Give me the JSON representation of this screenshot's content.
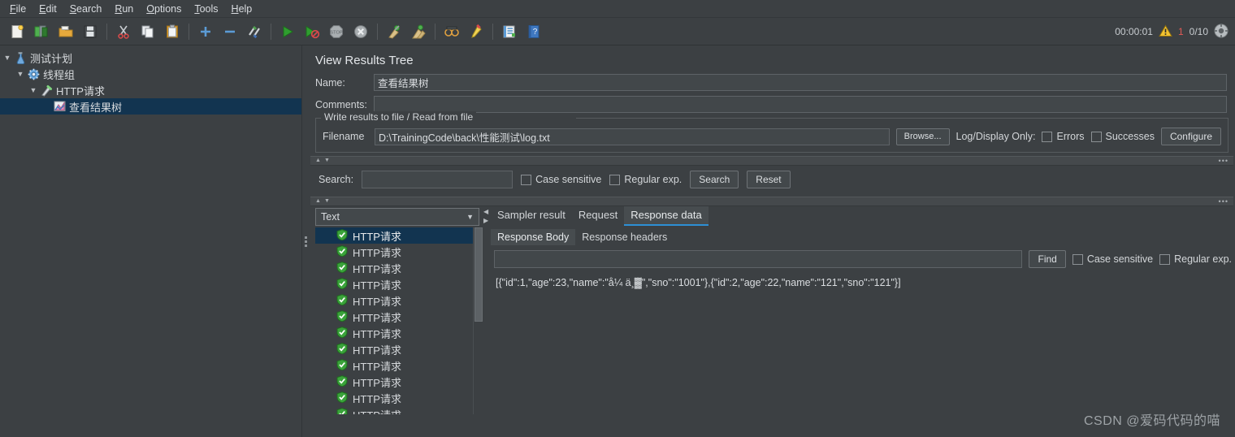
{
  "menubar": {
    "items": [
      {
        "label": "File",
        "mnemonic": "F"
      },
      {
        "label": "Edit",
        "mnemonic": "E"
      },
      {
        "label": "Search",
        "mnemonic": "S"
      },
      {
        "label": "Run",
        "mnemonic": "R"
      },
      {
        "label": "Options",
        "mnemonic": "O"
      },
      {
        "label": "Tools",
        "mnemonic": "T"
      },
      {
        "label": "Help",
        "mnemonic": "H"
      }
    ]
  },
  "toolbar": {
    "buttons": [
      {
        "name": "new-icon",
        "title": "New"
      },
      {
        "name": "templates-icon",
        "title": "Templates"
      },
      {
        "name": "open-icon",
        "title": "Open"
      },
      {
        "name": "save-icon",
        "title": "Save"
      },
      {
        "name": "cut-icon",
        "title": "Cut"
      },
      {
        "name": "copy-icon",
        "title": "Copy"
      },
      {
        "name": "paste-icon",
        "title": "Paste"
      },
      {
        "name": "expand-all-icon",
        "title": "Expand all"
      },
      {
        "name": "collapse-all-icon",
        "title": "Collapse all"
      },
      {
        "name": "toggle-icon",
        "title": "Toggle"
      },
      {
        "name": "start-icon",
        "title": "Start"
      },
      {
        "name": "start-no-pauses-icon",
        "title": "Start no pauses"
      },
      {
        "name": "stop-icon",
        "title": "Stop"
      },
      {
        "name": "shutdown-icon",
        "title": "Shutdown"
      },
      {
        "name": "clear-icon",
        "title": "Clear"
      },
      {
        "name": "clear-all-icon",
        "title": "Clear all"
      },
      {
        "name": "search-icon",
        "title": "Search"
      },
      {
        "name": "search-reset-icon",
        "title": "Reset search"
      },
      {
        "name": "function-helper-icon",
        "title": "Function helper dialog"
      },
      {
        "name": "help-icon",
        "title": "Help"
      }
    ]
  },
  "status": {
    "elapsed": "00:00:01",
    "warning_count": "1",
    "threads": "0/10",
    "warning_color": "#e05a57"
  },
  "tree": {
    "nodes": [
      {
        "label": "测试计划",
        "icon": "test-plan-icon",
        "depth": 0,
        "expanded": true,
        "selected": false
      },
      {
        "label": "线程组",
        "icon": "thread-group-icon",
        "depth": 1,
        "expanded": true,
        "selected": false
      },
      {
        "label": "HTTP请求",
        "icon": "http-request-icon",
        "depth": 2,
        "expanded": true,
        "selected": false
      },
      {
        "label": "查看结果树",
        "icon": "view-results-tree-icon",
        "depth": 3,
        "expanded": false,
        "selected": true
      }
    ]
  },
  "panel": {
    "title": "View Results Tree",
    "name_label": "Name:",
    "name_value": "查看结果树",
    "comments_label": "Comments:",
    "comments_value": "",
    "file_group": {
      "legend": "Write results to file / Read from file",
      "filename_label": "Filename",
      "filename_value": "D:\\TrainingCode\\back\\性能测试\\log.txt",
      "browse_label": "Browse...",
      "log_display_label": "Log/Display Only:",
      "errors_label": "Errors",
      "errors_checked": false,
      "successes_label": "Successes",
      "successes_checked": false,
      "configure_label": "Configure"
    },
    "search_bar": {
      "label": "Search:",
      "value": "",
      "case_sensitive_label": "Case sensitive",
      "case_sensitive_checked": false,
      "regex_label": "Regular exp.",
      "regex_checked": false,
      "search_button": "Search",
      "reset_button": "Reset"
    },
    "renderer": {
      "selected": "Text"
    },
    "results": [
      {
        "label": "HTTP请求",
        "status": "success",
        "selected": true
      },
      {
        "label": "HTTP请求",
        "status": "success",
        "selected": false
      },
      {
        "label": "HTTP请求",
        "status": "success",
        "selected": false
      },
      {
        "label": "HTTP请求",
        "status": "success",
        "selected": false
      },
      {
        "label": "HTTP请求",
        "status": "success",
        "selected": false
      },
      {
        "label": "HTTP请求",
        "status": "success",
        "selected": false
      },
      {
        "label": "HTTP请求",
        "status": "success",
        "selected": false
      },
      {
        "label": "HTTP请求",
        "status": "success",
        "selected": false
      },
      {
        "label": "HTTP请求",
        "status": "success",
        "selected": false
      },
      {
        "label": "HTTP请求",
        "status": "success",
        "selected": false
      },
      {
        "label": "HTTP请求",
        "status": "success",
        "selected": false
      },
      {
        "label": "HTTP请求",
        "status": "success",
        "selected": false
      }
    ],
    "tabs": [
      {
        "label": "Sampler result",
        "active": false
      },
      {
        "label": "Request",
        "active": false
      },
      {
        "label": "Response data",
        "active": true
      }
    ],
    "subtabs": [
      {
        "label": "Response Body",
        "active": true
      },
      {
        "label": "Response headers",
        "active": false
      }
    ],
    "find_bar": {
      "value": "",
      "find_button": "Find",
      "case_sensitive_label": "Case sensitive",
      "case_sensitive_checked": false,
      "regex_label": "Regular exp.",
      "regex_checked": false
    },
    "response_body": "[{\"id\":1,\"age\":23,\"name\":\"å¼ ä¸▓\",\"sno\":\"1001\"},{\"id\":2,\"age\":22,\"name\":\"121\",\"sno\":\"121\"}]"
  },
  "watermark": "CSDN @爱码代码的喵",
  "colors": {
    "background": "#3c4043",
    "selection": "#123450",
    "accent": "#2d8fd5",
    "success": "#3aa33a",
    "border": "#5e6367"
  }
}
